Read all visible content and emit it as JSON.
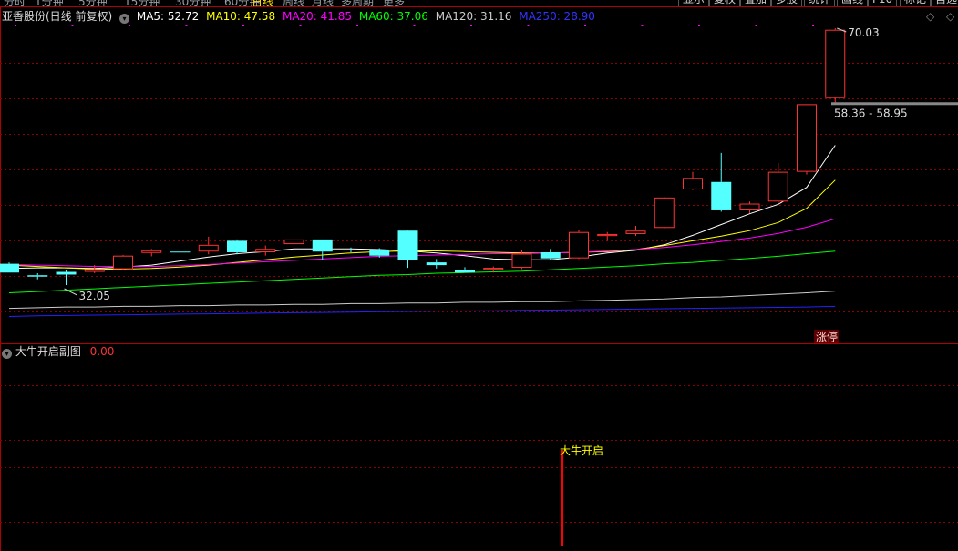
{
  "top_bar": {
    "periods": [
      "分时",
      "1分钟",
      "5分钟",
      "15分钟",
      "30分钟",
      "60分钟",
      "日线",
      "周线",
      "月线",
      "多周期",
      "更多"
    ],
    "active_period": "日线",
    "tools": [
      "显示",
      "复权",
      "叠加",
      "多股",
      "统计",
      "画线",
      "F10",
      "标记",
      "自选"
    ]
  },
  "main_panel": {
    "title": "亚香股份(日线 前复权)",
    "indicators": [
      {
        "label": "MA5: 52.72",
        "color": "#ffffff"
      },
      {
        "label": "MA10: 47.58",
        "color": "#ffff00"
      },
      {
        "label": "MA20: 41.85",
        "color": "#ff00ff"
      },
      {
        "label": "MA60: 37.06",
        "color": "#00ff00"
      },
      {
        "label": "MA120: 31.16",
        "color": "#cccccc"
      },
      {
        "label": "MA250: 28.90",
        "color": "#2222ff"
      }
    ]
  },
  "annotations": {
    "high_label": "70.03",
    "low_label": "32.05",
    "price_range": "58.36 - 58.95",
    "limit_up_badge": "涨停"
  },
  "sub_panel": {
    "title": "大牛开启副图",
    "value": "0.00",
    "signal_label": "大牛开启"
  },
  "colors": {
    "up": "#ff3232",
    "down": "#54ffff",
    "grid": "#8b0000",
    "border": "#b00000",
    "signal": "#ff0000",
    "signal_text": "#ffff00"
  },
  "chart_data": {
    "type": "candlestick",
    "price_axis_range": [
      28,
      72
    ],
    "candles": [
      {
        "o": 35.2,
        "h": 35.4,
        "l": 33.9,
        "c": 33.9
      },
      {
        "o": 33.5,
        "h": 33.8,
        "l": 32.9,
        "c": 33.3
      },
      {
        "o": 34.0,
        "h": 34.2,
        "l": 32.05,
        "c": 33.6
      },
      {
        "o": 34.0,
        "h": 35.0,
        "l": 33.8,
        "c": 34.4
      },
      {
        "o": 34.4,
        "h": 36.5,
        "l": 34.2,
        "c": 36.4
      },
      {
        "o": 36.8,
        "h": 37.4,
        "l": 36.3,
        "c": 37.2
      },
      {
        "o": 37.0,
        "h": 37.6,
        "l": 36.4,
        "c": 36.9
      },
      {
        "o": 37.0,
        "h": 39.2,
        "l": 36.6,
        "c": 38.0
      },
      {
        "o": 38.6,
        "h": 38.8,
        "l": 36.6,
        "c": 36.9
      },
      {
        "o": 36.9,
        "h": 37.9,
        "l": 36.4,
        "c": 37.4
      },
      {
        "o": 38.1,
        "h": 39.1,
        "l": 37.7,
        "c": 38.8
      },
      {
        "o": 38.8,
        "h": 38.8,
        "l": 35.8,
        "c": 37.0
      },
      {
        "o": 37.3,
        "h": 37.6,
        "l": 36.9,
        "c": 37.2
      },
      {
        "o": 37.3,
        "h": 37.5,
        "l": 36.1,
        "c": 36.4
      },
      {
        "o": 40.1,
        "h": 40.2,
        "l": 34.6,
        "c": 35.8
      },
      {
        "o": 35.4,
        "h": 35.9,
        "l": 34.5,
        "c": 35.0
      },
      {
        "o": 34.3,
        "h": 34.7,
        "l": 33.9,
        "c": 33.9
      },
      {
        "o": 34.3,
        "h": 34.8,
        "l": 33.9,
        "c": 34.6
      },
      {
        "o": 34.6,
        "h": 37.3,
        "l": 34.4,
        "c": 36.7
      },
      {
        "o": 36.9,
        "h": 37.4,
        "l": 35.8,
        "c": 36.0
      },
      {
        "o": 36.0,
        "h": 40.2,
        "l": 35.9,
        "c": 39.9
      },
      {
        "o": 39.3,
        "h": 39.9,
        "l": 38.6,
        "c": 39.6
      },
      {
        "o": 39.6,
        "h": 40.8,
        "l": 39.3,
        "c": 40.1
      },
      {
        "o": 40.5,
        "h": 45.1,
        "l": 40.4,
        "c": 45.0
      },
      {
        "o": 46.2,
        "h": 48.8,
        "l": 46.1,
        "c": 47.9
      },
      {
        "o": 47.3,
        "h": 51.6,
        "l": 42.9,
        "c": 43.1
      },
      {
        "o": 43.1,
        "h": 44.4,
        "l": 42.7,
        "c": 44.1
      },
      {
        "o": 44.4,
        "h": 50.1,
        "l": 44.2,
        "c": 48.8
      },
      {
        "o": 48.8,
        "h": 58.8,
        "l": 48.4,
        "c": 58.8
      },
      {
        "o": 59.7,
        "h": 70.03,
        "l": 59.0,
        "c": 69.8
      }
    ],
    "ma": [
      {
        "name": "MA5",
        "values": [
          34.5,
          34.6,
          34.6,
          34.5,
          34.7,
          35.0,
          35.6,
          36.2,
          36.7,
          37.0,
          37.4,
          37.4,
          37.4,
          37.3,
          37.1,
          36.8,
          36.4,
          35.9,
          35.8,
          35.8,
          36.2,
          36.8,
          37.2,
          38.0,
          39.4,
          41.0,
          42.6,
          44.0,
          46.5,
          52.72
        ]
      },
      {
        "name": "MA10",
        "values": [
          35.0,
          34.8,
          34.6,
          34.4,
          34.4,
          34.5,
          34.7,
          35.0,
          35.4,
          35.8,
          36.2,
          36.5,
          36.8,
          37.0,
          37.1,
          37.1,
          37.0,
          36.9,
          36.8,
          36.8,
          36.9,
          37.0,
          37.3,
          37.9,
          38.6,
          39.3,
          40.1,
          41.3,
          43.4,
          47.58
        ]
      },
      {
        "name": "MA20",
        "values": [
          35.1,
          35.0,
          34.9,
          34.8,
          34.8,
          34.8,
          34.9,
          35.1,
          35.3,
          35.5,
          35.7,
          35.9,
          36.1,
          36.3,
          36.4,
          36.5,
          36.6,
          36.7,
          36.7,
          36.8,
          36.9,
          37.1,
          37.3,
          37.6,
          38.0,
          38.5,
          39.0,
          39.7,
          40.6,
          41.85
        ]
      },
      {
        "name": "MA60",
        "values": [
          30.9,
          31.1,
          31.3,
          31.5,
          31.7,
          31.9,
          32.1,
          32.3,
          32.5,
          32.7,
          32.9,
          33.1,
          33.3,
          33.5,
          33.6,
          33.8,
          33.9,
          34.0,
          34.1,
          34.3,
          34.5,
          34.7,
          34.9,
          35.2,
          35.4,
          35.7,
          36.0,
          36.3,
          36.7,
          37.06
        ]
      },
      {
        "name": "MA120",
        "values": [
          28.6,
          28.7,
          28.8,
          28.8,
          28.9,
          28.9,
          29.0,
          29.0,
          29.1,
          29.1,
          29.2,
          29.2,
          29.3,
          29.3,
          29.4,
          29.4,
          29.5,
          29.5,
          29.6,
          29.6,
          29.7,
          29.8,
          29.9,
          30.0,
          30.2,
          30.3,
          30.5,
          30.7,
          30.9,
          31.16
        ]
      },
      {
        "name": "MA250",
        "values": [
          27.4,
          27.5,
          27.55,
          27.6,
          27.65,
          27.7,
          27.75,
          27.8,
          27.85,
          27.9,
          27.95,
          28.0,
          28.05,
          28.1,
          28.15,
          28.2,
          28.22,
          28.25,
          28.3,
          28.35,
          28.4,
          28.45,
          28.5,
          28.55,
          28.6,
          28.65,
          28.7,
          28.75,
          28.8,
          28.9
        ]
      }
    ]
  }
}
